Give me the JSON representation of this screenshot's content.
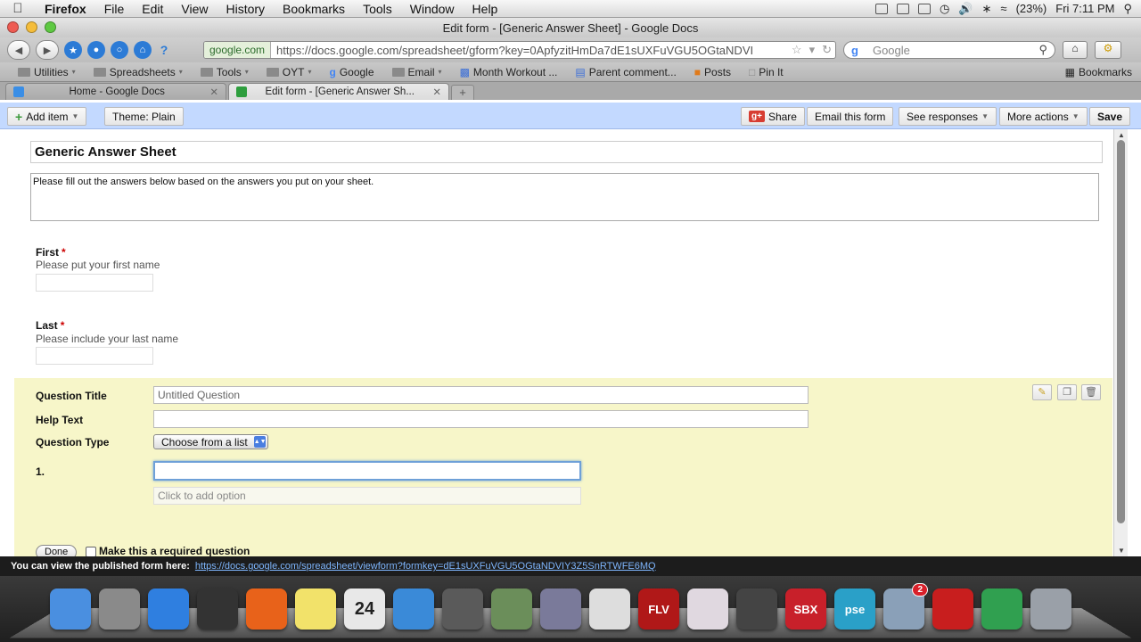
{
  "menubar": {
    "apple": "",
    "items": [
      "Firefox",
      "File",
      "Edit",
      "View",
      "History",
      "Bookmarks",
      "Tools",
      "Window",
      "Help"
    ],
    "battery": "(23%)",
    "clock": "Fri 7:11 PM"
  },
  "window": {
    "title": "Edit form - [Generic Answer Sheet] - Google Docs"
  },
  "toolbar": {
    "site_badge": "google.com",
    "url": "https://docs.google.com/spreadsheet/gform?key=0ApfyzitHmDa7dE1sUXFuVGU5OGtaNDVI",
    "search_engine": "g",
    "search_placeholder": "Google"
  },
  "bookmarks": {
    "items": [
      {
        "label": "Utilities",
        "caret": "▾"
      },
      {
        "label": "Spreadsheets",
        "caret": "▾"
      },
      {
        "label": "Tools",
        "caret": "▾"
      },
      {
        "label": "OYT",
        "caret": "▾"
      },
      {
        "label": "Google",
        "caret": ""
      },
      {
        "label": "Email",
        "caret": "▾"
      },
      {
        "label": "Month Workout ...",
        "caret": ""
      },
      {
        "label": "Parent comment...",
        "caret": ""
      },
      {
        "label": "Posts",
        "caret": ""
      },
      {
        "label": "Pin It",
        "caret": ""
      }
    ],
    "right_label": "Bookmarks"
  },
  "tabs": [
    {
      "label": "Home - Google Docs"
    },
    {
      "label": "Edit form - [Generic Answer Sh..."
    }
  ],
  "gbar": {
    "add_item": "Add item",
    "theme": "Theme:  Plain",
    "share": "Share",
    "gplus": "g+",
    "email_form": "Email this form",
    "see_responses": "See responses",
    "more_actions": "More actions",
    "save": "Save"
  },
  "form": {
    "title": "Generic Answer Sheet",
    "description": "Please fill out the answers below based on the answers you put on your sheet.",
    "questions": [
      {
        "label": "First",
        "required": "*",
        "help": "Please put your first name"
      },
      {
        "label": "Last",
        "required": "*",
        "help": "Please include your last name"
      }
    ]
  },
  "editor": {
    "question_title_label": "Question Title",
    "question_title_value": "Untitled Question",
    "help_text_label": "Help Text",
    "question_type_label": "Question Type",
    "question_type_value": "Choose from a list",
    "option_number": "1.",
    "add_option": "Click to add option",
    "done": "Done",
    "required_label": "Make this a required question"
  },
  "status": {
    "text": "You can view the published form here:",
    "link": "https://docs.google.com/spreadsheet/viewform?formkey=dE1sUXFuVGU5OGtaNDVIY3Z5SnRTWFE6MQ"
  },
  "dock": {
    "badge_mail": "2",
    "apps": [
      {
        "name": "finder",
        "color": "#4a8fe0",
        "label": ""
      },
      {
        "name": "system-preferences",
        "color": "#8a8a8a",
        "label": ""
      },
      {
        "name": "app-store",
        "color": "#2f7fe0",
        "label": ""
      },
      {
        "name": "dashboard",
        "color": "#333333",
        "label": ""
      },
      {
        "name": "firefox",
        "color": "#e8621a",
        "label": ""
      },
      {
        "name": "stickies",
        "color": "#f2e26a",
        "label": ""
      },
      {
        "name": "ical",
        "color": "#e8e8e8",
        "label": "24"
      },
      {
        "name": "itunes",
        "color": "#3a8ad8",
        "label": ""
      },
      {
        "name": "imovie",
        "color": "#5a5a5a",
        "label": ""
      },
      {
        "name": "iphoto",
        "color": "#6b8e5a",
        "label": ""
      },
      {
        "name": "aperture",
        "color": "#7a7a9a",
        "label": ""
      },
      {
        "name": "scrivener",
        "color": "#dddddd",
        "label": ""
      },
      {
        "name": "flv-player",
        "color": "#b01818",
        "label": "FLV"
      },
      {
        "name": "usb-drive",
        "color": "#e0d8e0",
        "label": ""
      },
      {
        "name": "screenflow",
        "color": "#444444",
        "label": ""
      },
      {
        "name": "sbx",
        "color": "#c8202a",
        "label": "SBX"
      },
      {
        "name": "pse",
        "color": "#2aa0c8",
        "label": "pse"
      },
      {
        "name": "mail",
        "color": "#8aa0b8",
        "label": ""
      },
      {
        "name": "acrobat",
        "color": "#c81e1e",
        "label": ""
      },
      {
        "name": "pixelmator",
        "color": "#30a050",
        "label": ""
      },
      {
        "name": "trash",
        "color": "#9aa0a8",
        "label": ""
      }
    ]
  }
}
